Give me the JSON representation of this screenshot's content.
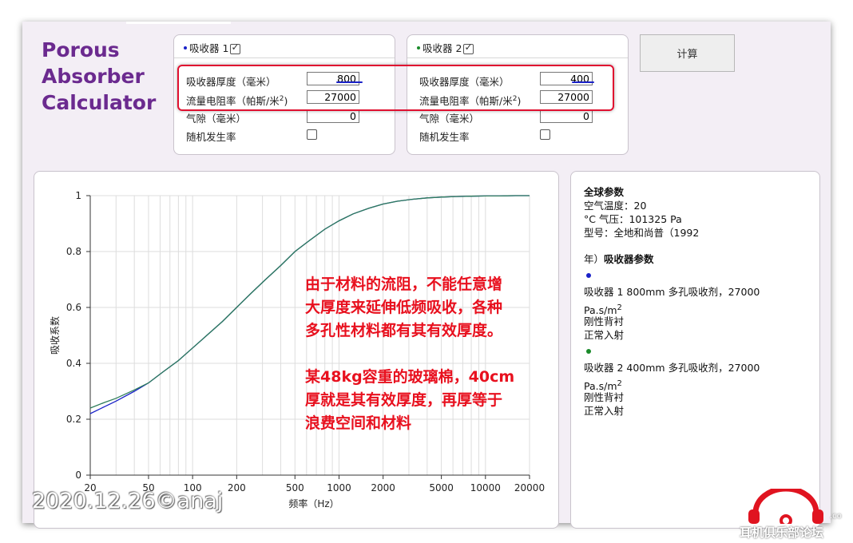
{
  "app": {
    "title_lines": [
      "Porous",
      "Absorber",
      "Calculator"
    ]
  },
  "absorber1": {
    "title": "吸收器 1",
    "dot_color": "#1a22c8",
    "thickness_label": "吸收器厚度（毫米）",
    "thickness_value": "800",
    "resistivity_label": "流量电阻率（帕斯/米",
    "resistivity_sup": "2",
    "resistivity_close": ")",
    "resistivity_value": "27000",
    "airgap_label": "气隙（毫米）",
    "airgap_value": "0",
    "random_label": "随机发生率"
  },
  "absorber2": {
    "title": "吸收器 2",
    "dot_color": "#1a8a2a",
    "thickness_label": "吸收器厚度（毫米）",
    "thickness_value": "400",
    "resistivity_label": "流量电阻率（帕斯/米",
    "resistivity_sup": "2",
    "resistivity_close": ")",
    "resistivity_value": "27000",
    "airgap_label": "气隙（毫米）",
    "airgap_value": "0",
    "random_label": "随机发生率"
  },
  "calculate_button": "计算",
  "info": {
    "global_header": "全球参数",
    "air_temp": "空气温度：20",
    "pressure": "°C 气压：101325 Pa",
    "model": "型号：全地和尚普（1992",
    "absorber_header_prefix": "年）",
    "absorber_header": "吸收器参数",
    "abs1_line1": "吸收器 1 800mm 多孔吸收剂，27000",
    "abs1_line2": "Pa.s/m",
    "abs1_sup": "2",
    "abs1_line3": "刚性背衬",
    "abs1_line4": "正常入射",
    "abs2_line1": "吸收器 2 400mm 多孔吸收剂，27000",
    "abs2_line2": "Pa.s/m",
    "abs2_sup": "2",
    "abs2_line3": "刚性背衬",
    "abs2_line4": "正常入射"
  },
  "annotation": {
    "lines": [
      "由于材料的流阻，不能任意增",
      "大厚度来延伸低频吸收，各种",
      "多孔性材料都有其有效厚度。",
      "",
      "某48kg容重的玻璃棉，40cm",
      "厚就是其有效厚度，再厚等于",
      "浪费空间和材料"
    ],
    "color": "#e8101e"
  },
  "watermark": "2020.12.26©anaj",
  "logo_text": "耳机俱乐部论坛",
  "logo_suffix": ".co",
  "chart_data": {
    "type": "line",
    "xlabel": "频率（Hz）",
    "ylabel": "吸收系数",
    "xscale": "log",
    "xlim": [
      20,
      20000
    ],
    "ylim": [
      0,
      1
    ],
    "xticks": [
      20,
      50,
      100,
      200,
      500,
      1000,
      2000,
      5000,
      10000,
      20000
    ],
    "xtick_labels": [
      "20",
      "50",
      "100",
      "200",
      "500",
      "1000",
      "2000",
      "5000",
      "10000",
      "20000"
    ],
    "yticks": [
      0,
      0.2,
      0.4,
      0.6,
      0.8,
      1
    ],
    "ytick_labels": [
      "0",
      "0.2",
      "0.4",
      "0.6",
      "0.8",
      "1"
    ],
    "grid": true,
    "series": [
      {
        "color": "#1a22c8",
        "x": [
          20,
          25,
          30,
          40,
          50,
          63,
          80,
          100,
          125,
          160,
          200,
          250,
          315,
          400,
          500,
          630,
          800,
          1000,
          1250,
          1600,
          2000,
          2500,
          3150,
          4000,
          5000,
          6300,
          8000,
          10000,
          12500,
          16000,
          20000
        ],
        "y": [
          0.22,
          0.245,
          0.265,
          0.3,
          0.33,
          0.37,
          0.41,
          0.455,
          0.5,
          0.55,
          0.6,
          0.65,
          0.7,
          0.75,
          0.8,
          0.84,
          0.88,
          0.91,
          0.935,
          0.955,
          0.97,
          0.98,
          0.987,
          0.992,
          0.995,
          0.997,
          0.998,
          0.999,
          0.999,
          1.0,
          1.0
        ]
      },
      {
        "color": "#2e7d5a",
        "x": [
          20,
          25,
          30,
          40,
          50,
          63,
          80,
          100,
          125,
          160,
          200,
          250,
          315,
          400,
          500,
          630,
          800,
          1000,
          1250,
          1600,
          2000,
          2500,
          3150,
          4000,
          5000,
          6300,
          8000,
          10000,
          12500,
          16000,
          20000
        ],
        "y": [
          0.24,
          0.26,
          0.275,
          0.305,
          0.33,
          0.37,
          0.41,
          0.455,
          0.5,
          0.55,
          0.6,
          0.65,
          0.7,
          0.75,
          0.8,
          0.84,
          0.88,
          0.91,
          0.935,
          0.955,
          0.97,
          0.98,
          0.987,
          0.992,
          0.995,
          0.997,
          0.998,
          0.999,
          0.999,
          1.0,
          1.0
        ]
      }
    ]
  }
}
